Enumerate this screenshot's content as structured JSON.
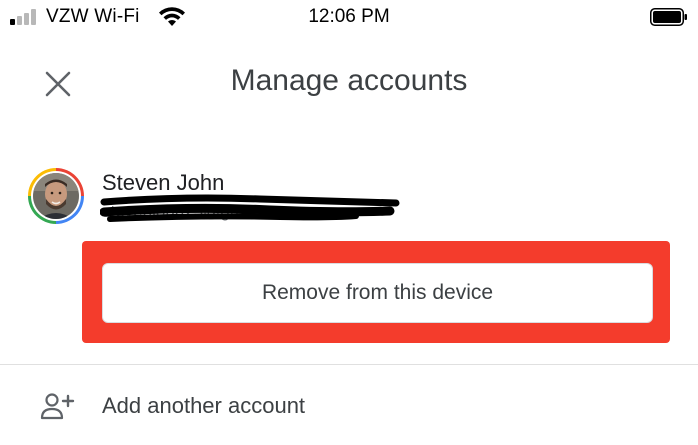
{
  "status_bar": {
    "carrier": "VZW Wi-Fi",
    "time": "12:06 PM",
    "signal_bars_filled": 1,
    "signal_bars_total": 4
  },
  "header": {
    "title": "Manage accounts",
    "close_icon": "close-icon"
  },
  "account": {
    "name": "Steven John",
    "email": "stevenjohn23@gmail.com",
    "email_redacted": true
  },
  "actions": {
    "remove_label": "Remove from this device",
    "add_account_label": "Add another account",
    "add_account_icon": "person-add-icon"
  },
  "colors": {
    "highlight": "#f43c2c",
    "google_red": "#ea4335",
    "google_blue": "#4285f4",
    "google_green": "#34a853",
    "google_yellow": "#fbbc05"
  }
}
